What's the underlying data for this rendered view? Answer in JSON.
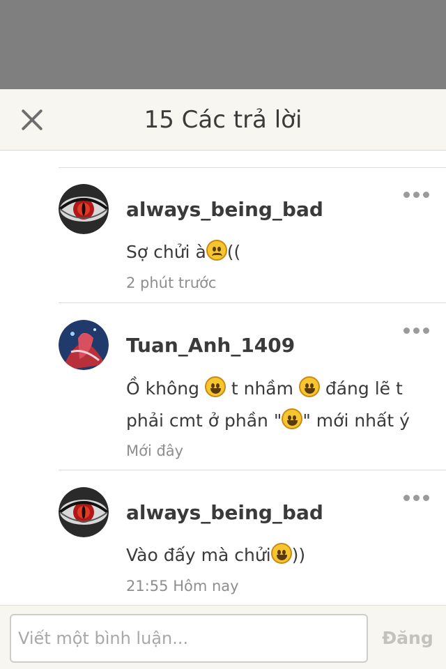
{
  "header": {
    "title": "15 Các trả lời",
    "close_icon": "close-icon"
  },
  "comments": [
    {
      "username": "always_being_bad",
      "text_parts": [
        "Sợ chửi à",
        "frown-emoji",
        "(("
      ],
      "text_a": "Sợ chửi à",
      "text_b": "((",
      "time": "2 phút trước",
      "avatar": "red-eye-avatar"
    },
    {
      "username": "Tuan_Anh_1409",
      "text_line1_a": "Ồ không ",
      "text_line1_b": " t nhầm ",
      "text_line1_c": " đáng lẽ t",
      "text_line2_a": "phải cmt ở phần \"",
      "text_line2_b": "\" mới nhất ý",
      "time": "Mới đây",
      "avatar": "anime-girl-avatar"
    },
    {
      "username": "always_being_bad",
      "text_a": "Vào đấy mà chửi",
      "text_b": "))",
      "time": "21:55 Hôm nay",
      "avatar": "red-eye-avatar"
    }
  ],
  "footer": {
    "input_placeholder": "Viết một bình luận...",
    "post_label": "Đăng"
  },
  "colors": {
    "overlay": "#7f7f7f",
    "header_bg": "#f7f6f1",
    "text": "#3a3a3a",
    "muted": "#8e8e8e"
  }
}
